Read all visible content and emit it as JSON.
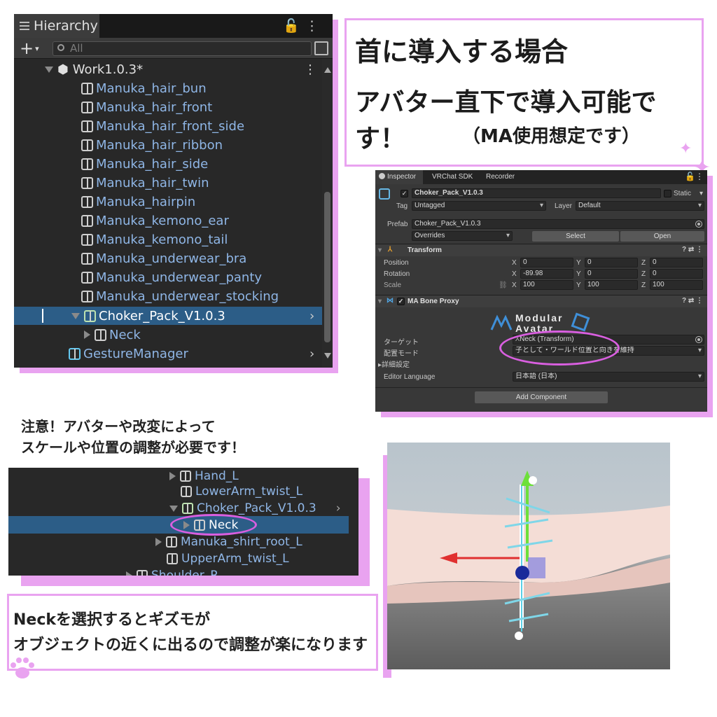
{
  "hierarchy": {
    "tab_label": "Hierarchy",
    "search_placeholder": "All",
    "scene_name": "Work1.0.3*",
    "items": [
      "Manuka_hair_bun",
      "Manuka_hair_front",
      "Manuka_hair_front_side",
      "Manuka_hair_ribbon",
      "Manuka_hair_side",
      "Manuka_hair_twin",
      "Manuka_hairpin",
      "Manuka_kemono_ear",
      "Manuka_kemono_tail",
      "Manuka_underwear_bra",
      "Manuka_underwear_panty",
      "Manuka_underwear_stocking"
    ],
    "selected_item": "Choker_Pack_V1.0.3",
    "child_item": "Neck",
    "last_item": "GestureManager"
  },
  "title": {
    "line1": "首に導入する場合",
    "line2": "アバター直下で導入可能です！",
    "line3": "（MA使用想定です）"
  },
  "inspector": {
    "tabs": [
      "Inspector",
      "VRChat SDK",
      "Recorder"
    ],
    "object_name": "Choker_Pack_V1.0.3",
    "static_label": "Static",
    "tag_label": "Tag",
    "tag_value": "Untagged",
    "layer_label": "Layer",
    "layer_value": "Default",
    "prefab_label": "Prefab",
    "prefab_value": "Choker_Pack_V1.0.3",
    "overrides": "Overrides",
    "select_button": "Select",
    "open_button": "Open",
    "transform_header": "Transform",
    "position_label": "Position",
    "rotation_label": "Rotation",
    "scale_label": "Scale",
    "axis_x": "X",
    "axis_y": "Y",
    "axis_z": "Z",
    "position": [
      "0",
      "0",
      "0"
    ],
    "rotation": [
      "-89.98",
      "0",
      "0"
    ],
    "scale": [
      "100",
      "100",
      "100"
    ],
    "ma_header": "MA Bone Proxy",
    "logo_text": "Modular Avatar",
    "target_label": "ターゲット",
    "target_value": "Neck (Transform)",
    "mode_label": "配置モード",
    "mode_value": "子として・ワールド位置と向きを維持",
    "advanced_label": "詳細設定",
    "language_label": "Editor Language",
    "language_value": "日本語 (日本)",
    "add_component": "Add Component"
  },
  "note": {
    "line1": "注意！アバターや改変によって",
    "line2": "スケールや位置の調整が必要です！"
  },
  "hierarchy2": {
    "items": [
      "Hand_L",
      "LowerArm_twist_L",
      "Choker_Pack_V1.0.3",
      "Neck",
      "Manuka_shirt_root_L",
      "UpperArm_twist_L",
      "Shoulder_R"
    ]
  },
  "bottom": {
    "line1": "Neckを選択するとギズモが",
    "line2": "オブジェクトの近くに出るので調整が楽になります"
  },
  "colors": {
    "accent_pink": "#e9a3f0",
    "oval_magenta": "#d95fe0",
    "selection_blue": "#2c5d87",
    "item_blue": "#8fb6e6"
  }
}
